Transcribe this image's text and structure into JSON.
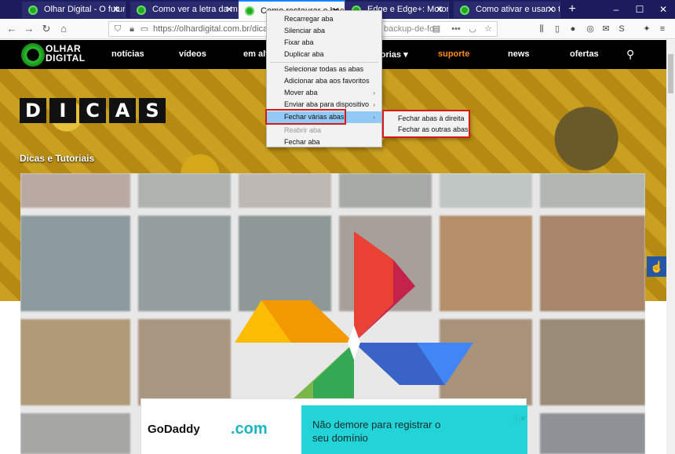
{
  "browser": {
    "tabs": [
      {
        "title": "Olhar Digital - O futuro pa"
      },
      {
        "title": "Como ver a letra da músic"
      },
      {
        "title": "Como restaurar o backup"
      },
      {
        "title": "Edge e Edge+: Motorola la"
      },
      {
        "title": "Como ativar e usar o tema"
      }
    ],
    "active_tab": 2,
    "new_tab_symbol": "+",
    "window_buttons": [
      "–",
      "☐",
      "✕"
    ],
    "url": "https://olhardigital.com.br/dicas_e_",
    "url_tail": "backup-de-fo",
    "overflow_symbol": "•••"
  },
  "site": {
    "logo_text_line1": "OLHAR",
    "logo_text_line2": "DIGITAL",
    "nav": [
      "notícias",
      "vídeos",
      "em alta",
      "categorias ▾",
      "suporte",
      "news",
      "ofertas"
    ],
    "hero_letters": [
      "D",
      "I",
      "C",
      "A",
      "S"
    ],
    "section_title": "Dicas e Tutoriais"
  },
  "ad": {
    "brand": "GoDaddy",
    "product": ".com",
    "line1": "Não demore para registrar o",
    "line2": "seu domínio",
    "close": "ⓘ✕"
  },
  "context_menu": {
    "items": [
      {
        "label": "Recarregar aba"
      },
      {
        "label": "Silenciar aba"
      },
      {
        "label": "Fixar aba"
      },
      {
        "label": "Duplicar aba"
      },
      {
        "label": "Selecionar todas as abas"
      },
      {
        "label": "Adicionar aba aos favoritos"
      },
      {
        "label": "Mover aba"
      },
      {
        "label": "Enviar aba para dispositivo"
      },
      {
        "label": "Fechar várias abas"
      },
      {
        "label": "Reabrir aba"
      },
      {
        "label": "Fechar aba"
      }
    ],
    "submenu": [
      {
        "label": "Fechar abas à direita"
      },
      {
        "label": "Fechar as outras abas"
      }
    ]
  },
  "colors": {
    "tab_strip": "#1c1b5e",
    "highlight": "#91c9f7",
    "callout_red": "#d51a1a",
    "accent_nav": "#ff8c1a",
    "ad_bg": "#22d3d8"
  }
}
